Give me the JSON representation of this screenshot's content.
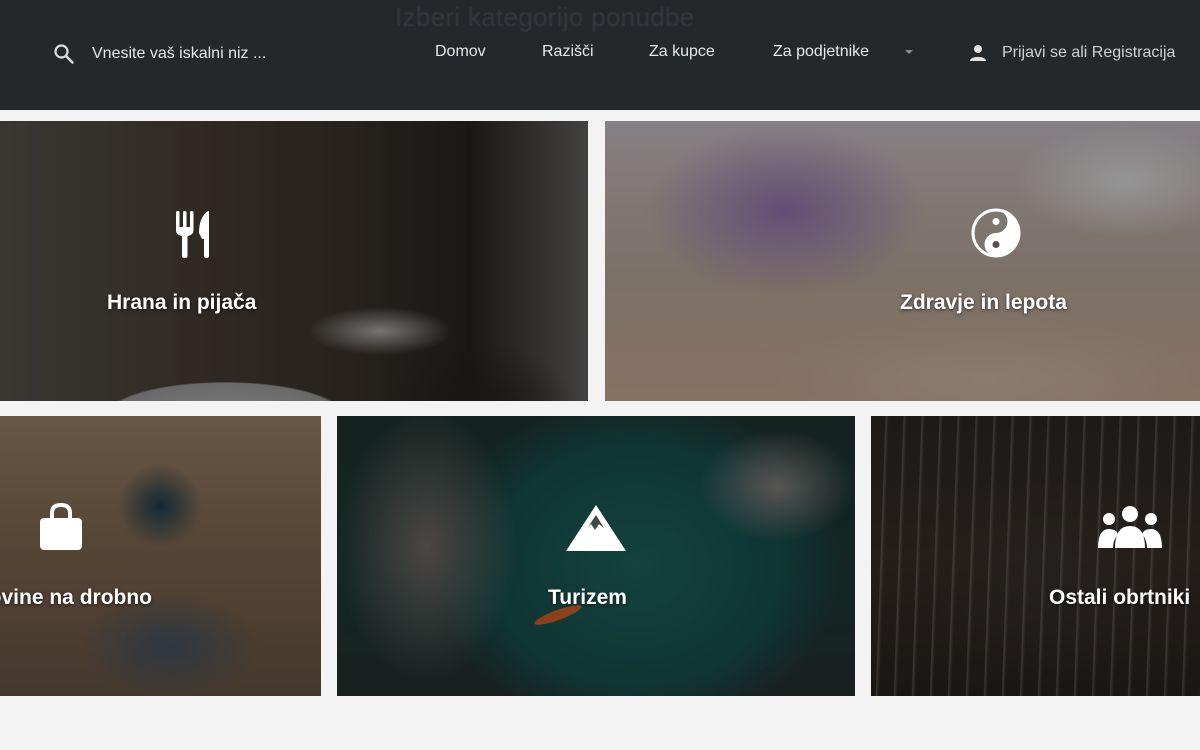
{
  "header": {
    "ghost_title": "Izberi kategorijo ponudbe",
    "search": {
      "placeholder": "Vnesite vaš iskalni niz ..."
    },
    "nav": [
      {
        "label": "Domov"
      },
      {
        "label": "Razišči"
      },
      {
        "label": "Za kupce"
      },
      {
        "label": "Za podjetnike"
      }
    ],
    "login_label": "Prijavi se ali Registracija"
  },
  "tiles": [
    {
      "label": "Hrana in pijača",
      "icon": "fork-knife-icon"
    },
    {
      "label": "Zdravje in lepota",
      "icon": "yin-yang-icon"
    },
    {
      "label": "Trgovine na drobno",
      "icon": "shopping-bag-icon"
    },
    {
      "label": "Turizem",
      "icon": "mountain-icon"
    },
    {
      "label": "Ostali obrtniki",
      "icon": "group-icon"
    }
  ],
  "colors": {
    "header_bg": "#25282b",
    "page_bg": "#f3f3f3",
    "text_light": "#e8e8e8"
  }
}
